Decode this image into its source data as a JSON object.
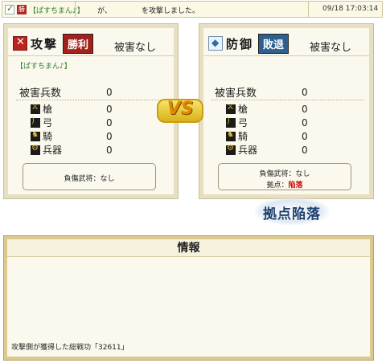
{
  "topbar": {
    "player": "【ぱすちまん♪】",
    "connector": "が、",
    "action": "を攻撃しました。",
    "timestamp": "09/18 17:03:14",
    "seal_label": "勝"
  },
  "attacker": {
    "role": "攻撃",
    "result": "勝利",
    "damage_status": "被害なし",
    "player": "【ぱすちまん♪】",
    "total_label": "被害兵数",
    "total_value": "0",
    "units": [
      {
        "label": "槍",
        "value": "0",
        "icon": "spear-icon"
      },
      {
        "label": "弓",
        "value": "0",
        "icon": "bow-icon"
      },
      {
        "label": "騎",
        "value": "0",
        "icon": "horse-icon"
      },
      {
        "label": "兵器",
        "value": "0",
        "icon": "weapon-icon"
      }
    ],
    "casualty_line": "負傷武将：なし"
  },
  "defender": {
    "role": "防御",
    "result": "敗退",
    "damage_status": "被害なし",
    "total_label": "被害兵数",
    "total_value": "0",
    "units": [
      {
        "label": "槍",
        "value": "0",
        "icon": "spear-icon"
      },
      {
        "label": "弓",
        "value": "0",
        "icon": "bow-icon"
      },
      {
        "label": "騎",
        "value": "0",
        "icon": "horse-icon"
      },
      {
        "label": "兵器",
        "value": "0",
        "icon": "weapon-icon"
      }
    ],
    "casualty_line": "負傷武将：なし",
    "base_label": "拠点：",
    "base_status": "陥落"
  },
  "vs_label": "VS",
  "stamp_label": "拠点陥落",
  "info": {
    "title": "情報",
    "note": "攻撃側が獲得した総戦功「32611」"
  },
  "colors": {
    "win": "#a4201c",
    "lose": "#2f5f8f",
    "fallen": "#d01010",
    "player_link": "#2e7d2e"
  }
}
